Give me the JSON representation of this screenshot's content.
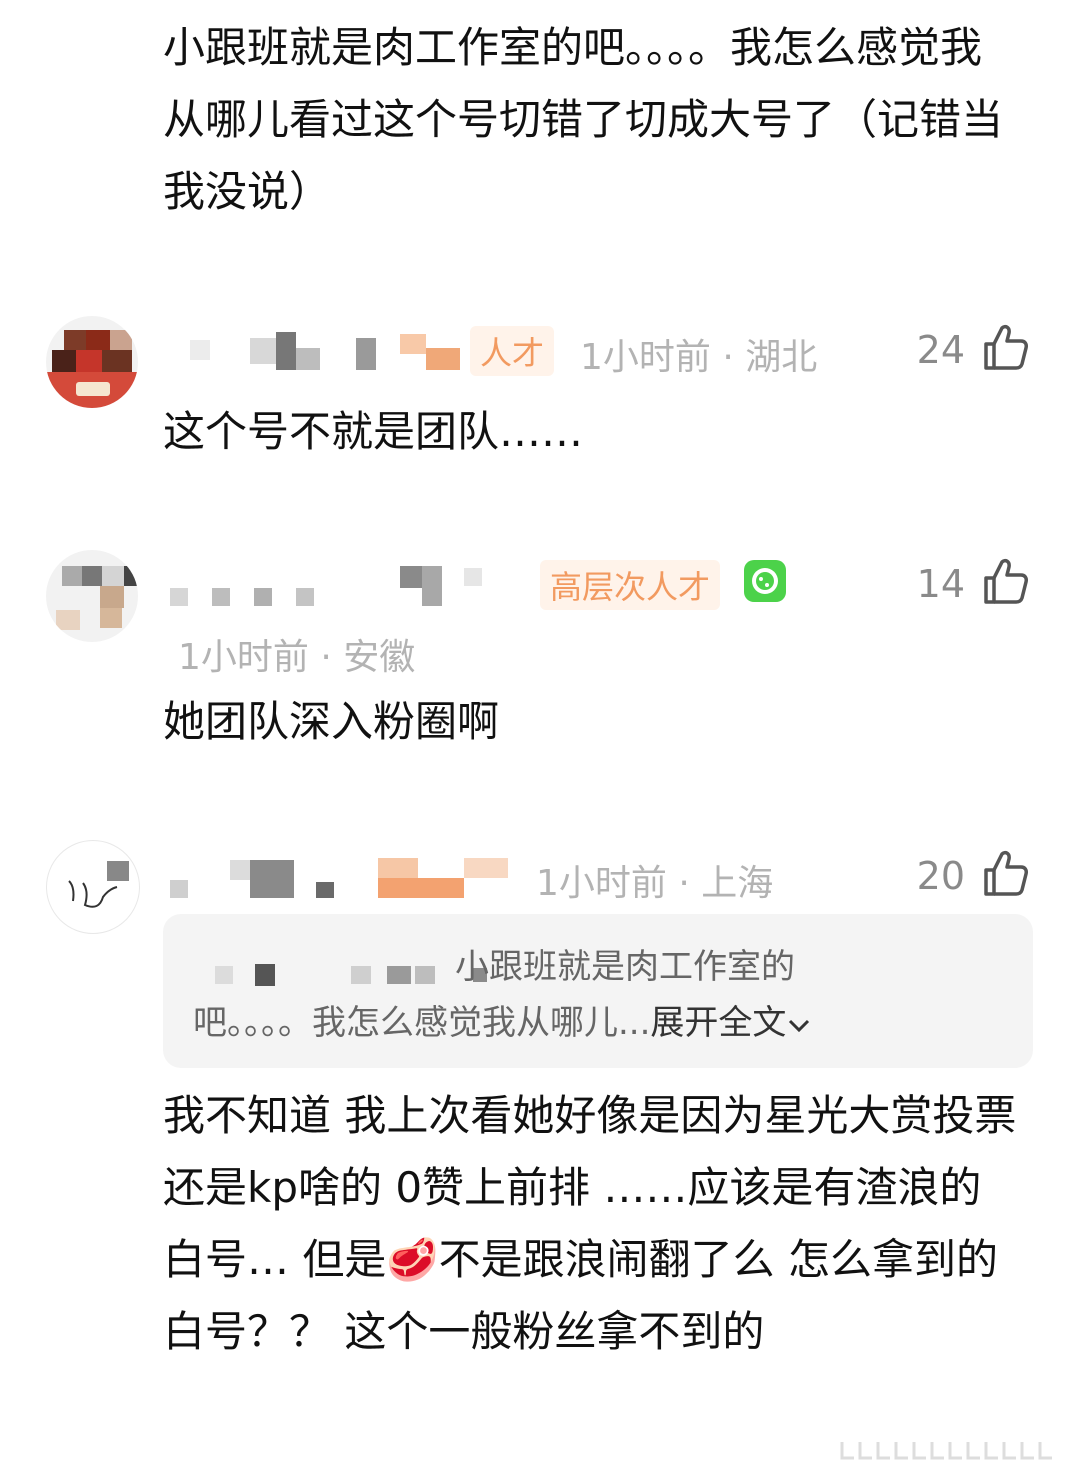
{
  "top_comment": {
    "text": "小跟班就是肉工作室的吧。。。。我怎么感觉我从哪儿看过这个号切错了切成大号了（记错当我没说）"
  },
  "comments": [
    {
      "badge": "人才",
      "time": "1小时前",
      "separator": "·",
      "location": "湖北",
      "likes": "24",
      "text": "这个号不就是团队……"
    },
    {
      "badge": "高层次人才",
      "time": "1小时前",
      "separator": "·",
      "location": "安徽",
      "likes": "14",
      "text": "她团队深入粉圈啊"
    },
    {
      "time": "1小时前",
      "separator": "·",
      "location": "上海",
      "likes": "20",
      "quote_line1": "小跟班就是肉工作室的",
      "quote_line2": "吧。。。。我怎么感觉我从哪儿...",
      "quote_expand": "展开全文",
      "text": "我不知道 我上次看她好像是因为星光大赏投票还是kp啥的 0赞上前排 ……应该是有渣浪的白号… 但是🥩不是跟浪闹翻了么 怎么拿到的白号？？ 这个一般粉丝拿不到的"
    }
  ],
  "colors": {
    "badge_text": "#f29a60",
    "badge_bg": "#fff3ea",
    "meta_text": "#b3b3b3",
    "vip_green": "#4cd24a"
  }
}
